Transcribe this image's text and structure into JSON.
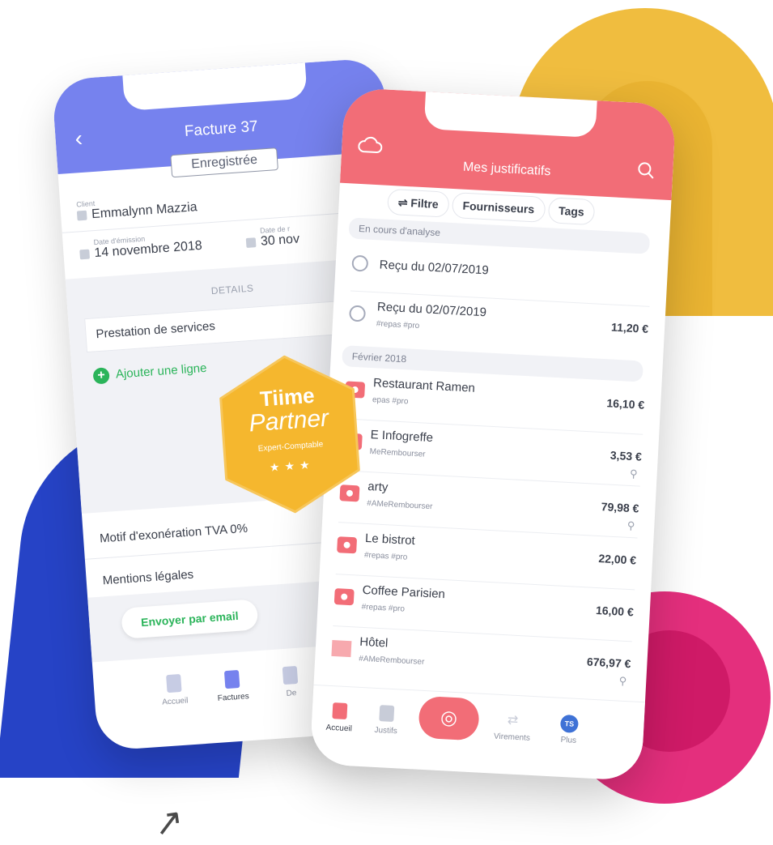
{
  "invoice": {
    "title": "Facture 37",
    "status": "Enregistrée",
    "client_label": "Client",
    "client_name": "Emmalynn Mazzia",
    "issue_date_label": "Date d'émission",
    "issue_date": "14 novembre 2018",
    "due_date_label": "Date de r",
    "due_date": "30 nov",
    "details_label": "DETAILS",
    "line_item": "Prestation de services",
    "add_line": "Ajouter une ligne",
    "vat_exemption": "Motif d'exonération TVA 0%",
    "legal_mentions": "Mentions légales",
    "send_email": "Envoyer par email",
    "tabs": [
      "Accueil",
      "Factures",
      "De"
    ]
  },
  "receipts": {
    "title": "Mes justificatifs",
    "filters": [
      "Filtre",
      "Fournisseurs",
      "Tags"
    ],
    "section_analyzing": "En cours d'analyse",
    "section_feb": "Février 2018",
    "items": [
      {
        "name": "Reçu du 02/07/2019",
        "tags": "",
        "amount": "",
        "icon": "clock-icon"
      },
      {
        "name": "Reçu du 02/07/2019",
        "tags": "#repas #pro",
        "amount": "11,20 €",
        "icon": "clock-icon"
      },
      {
        "name": "Restaurant Ramen",
        "tags": "epas #pro",
        "amount": "16,10 €",
        "icon": "camera-icon"
      },
      {
        "name": "E Infogreffe",
        "tags": "MeRembourser",
        "amount": "3,53 €",
        "icon": "camera-icon",
        "clip": "⚲"
      },
      {
        "name": "arty",
        "tags": "#AMeRembourser",
        "amount": "79,98 €",
        "icon": "camera-icon",
        "clip": "⚲"
      },
      {
        "name": "Le bistrot",
        "tags": "#repas #pro",
        "amount": "22,00 €",
        "icon": "camera-icon"
      },
      {
        "name": "Coffee Parisien",
        "tags": "#repas #pro",
        "amount": "16,00 €",
        "icon": "camera-icon"
      },
      {
        "name": "Hôtel",
        "tags": "#AMeRembourser",
        "amount": "676,97 €",
        "icon": "mail-icon",
        "clip": "⚲"
      }
    ],
    "tabs": [
      "Accueil",
      "Justifs",
      "Virements",
      "Plus"
    ],
    "avatar_initials": "TS"
  },
  "badge": {
    "line1": "Tiime",
    "line2": "Partner",
    "line3": "Expert-Comptable",
    "stars": "★★★"
  },
  "colors": {
    "invoice_header": "#7682ee",
    "receipts_header": "#f26d77",
    "badge": "#f5b72e",
    "accent_green": "#2bb45a"
  }
}
